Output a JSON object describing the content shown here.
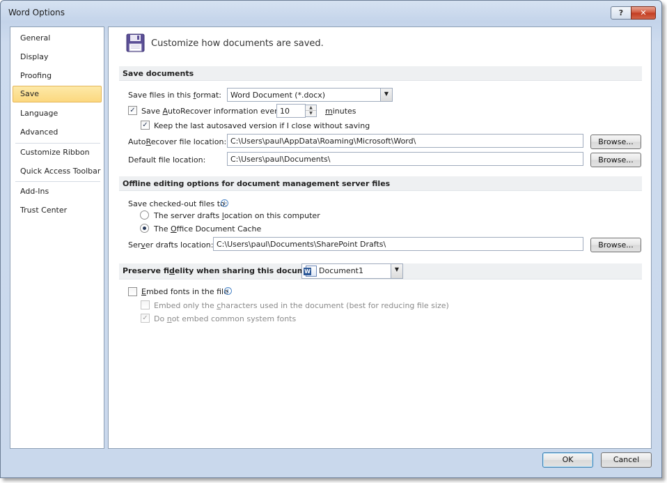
{
  "window": {
    "title": "Word Options",
    "help_glyph": "?",
    "close_glyph": "✕"
  },
  "sidebar": {
    "items": [
      {
        "label": "General"
      },
      {
        "label": "Display"
      },
      {
        "label": "Proofing"
      },
      {
        "label": "Save",
        "selected": true
      },
      {
        "label": "Language"
      },
      {
        "label": "Advanced"
      },
      {
        "label": "Customize Ribbon"
      },
      {
        "label": "Quick Access Toolbar"
      },
      {
        "label": "Add-Ins"
      },
      {
        "label": "Trust Center"
      }
    ]
  },
  "main": {
    "headline": "Customize how documents are saved.",
    "save_documents": {
      "header": "Save documents",
      "format_label_pre": "Save files in this ",
      "format_label_accel": "f",
      "format_label_post": "ormat:",
      "format_value": "Word Document (*.docx)",
      "autorecover_checked": true,
      "autorecover_pre": "Save ",
      "autorecover_accel": "A",
      "autorecover_post": "utoRecover information every",
      "autorecover_minutes": "10",
      "minutes_accel": "m",
      "minutes_post": "inutes",
      "keep_last_checked": true,
      "keep_last_label": "Keep the last autosaved version if I close without saving",
      "autorecover_loc_pre": "Auto",
      "autorecover_loc_accel": "R",
      "autorecover_loc_post": "ecover file location:",
      "autorecover_loc_value": "C:\\Users\\paul\\AppData\\Roaming\\Microsoft\\Word\\",
      "default_loc_pre": "Default f",
      "default_loc_accel": "i",
      "default_loc_post": "le location:",
      "default_loc_value": "C:\\Users\\paul\\Documents\\",
      "browse_label": "Browse..."
    },
    "offline": {
      "header": "Offline editing options for document management server files",
      "checkout_label": "Save checked-out files to:",
      "server_drafts_pre": "The server drafts ",
      "server_drafts_accel": "l",
      "server_drafts_post": "ocation on this computer",
      "server_drafts_selected": false,
      "office_cache_pre": "The ",
      "office_cache_accel": "O",
      "office_cache_post": "ffice Document Cache",
      "office_cache_selected": true,
      "server_loc_pre": "Ser",
      "server_loc_accel": "v",
      "server_loc_post": "er drafts location:",
      "server_loc_value": "C:\\Users\\paul\\Documents\\SharePoint Drafts\\",
      "browse_label": "Browse..."
    },
    "fidelity": {
      "header_pre": "Preserve fi",
      "header_accel": "d",
      "header_post": "elity when sharing this document:",
      "document_value": "Document1",
      "embed_fonts_checked": false,
      "embed_fonts_accel": "E",
      "embed_fonts_post": "mbed fonts in the file",
      "embed_chars_checked": false,
      "embed_chars_pre": "Embed only the ",
      "embed_chars_accel": "c",
      "embed_chars_post": "haracters used in the document (best for reducing file size)",
      "no_common_checked": true,
      "no_common_pre": "Do ",
      "no_common_accel": "n",
      "no_common_post": "ot embed common system fonts"
    }
  },
  "footer": {
    "ok_label": "OK",
    "cancel_label": "Cancel"
  },
  "icons": {
    "check": "✓",
    "info": "i",
    "dropdown": "▼",
    "spin_up": "▲",
    "spin_down": "▼"
  }
}
